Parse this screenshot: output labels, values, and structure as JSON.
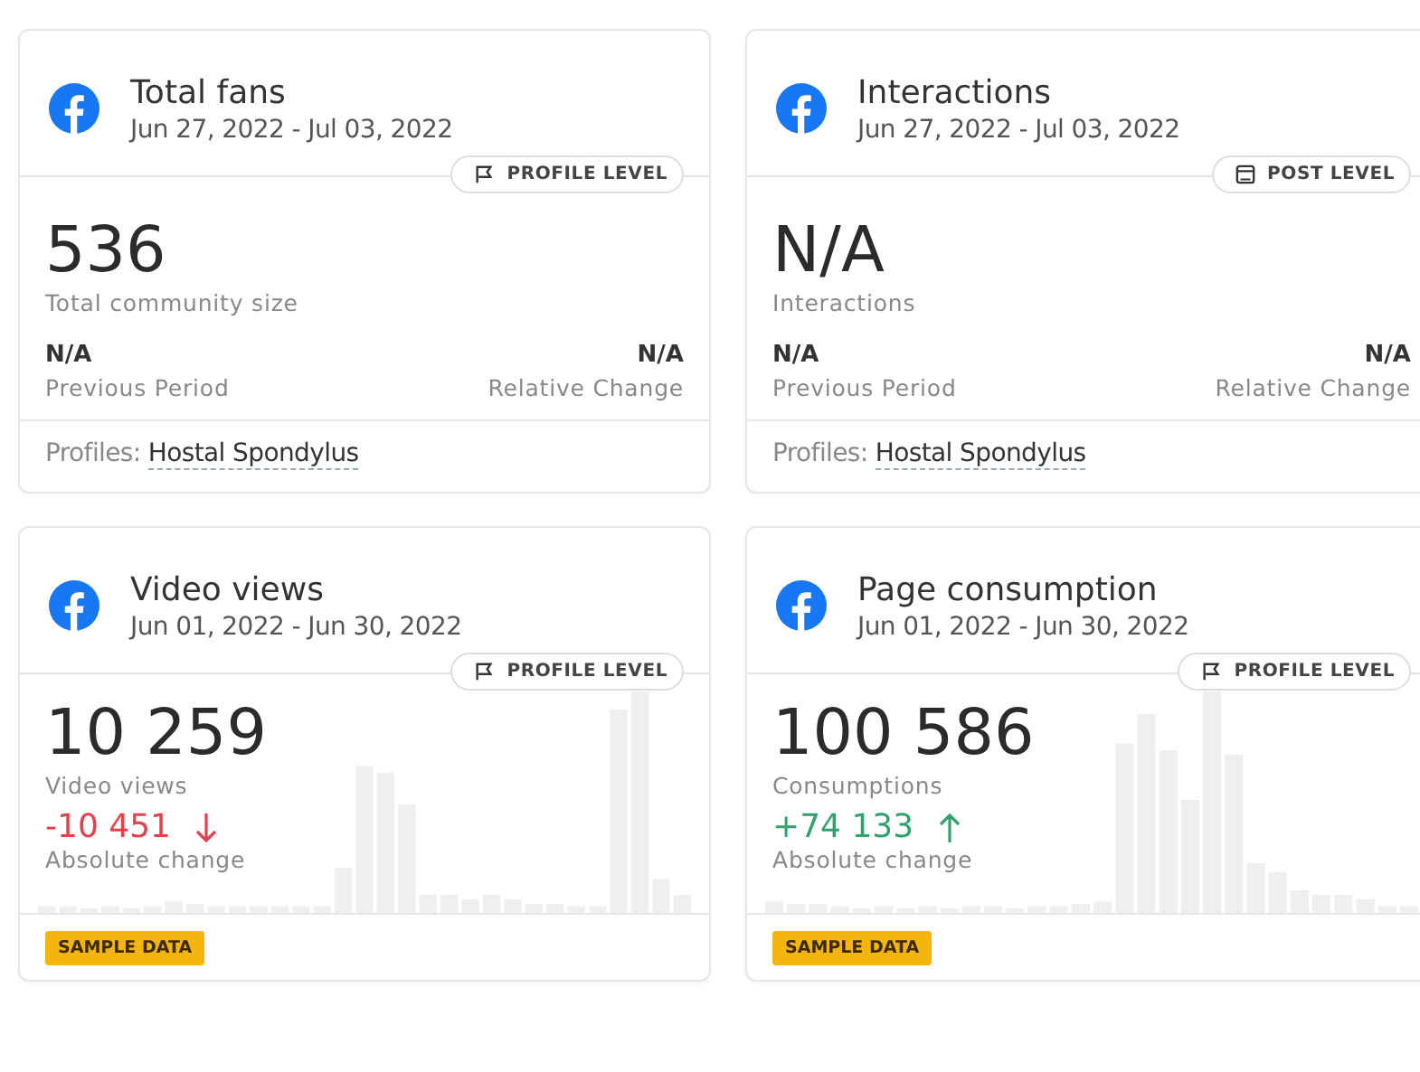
{
  "cards": [
    {
      "kind": "summary",
      "title": "Total fans",
      "date_range": "Jun 27, 2022 - Jul 03, 2022",
      "badge": {
        "kind": "profile",
        "label": "PROFILE LEVEL"
      },
      "value": "536",
      "value_label": "Total community size",
      "previous": {
        "value": "N/A",
        "label": "Previous Period"
      },
      "change": {
        "value": "N/A",
        "label": "Relative Change"
      },
      "profiles_label": "Profiles:",
      "profile_link": "Hostal Spondylus"
    },
    {
      "kind": "summary",
      "title": "Interactions",
      "date_range": "Jun 27, 2022 - Jul 03, 2022",
      "badge": {
        "kind": "post",
        "label": "POST LEVEL"
      },
      "value": "N/A",
      "value_label": "Interactions",
      "previous": {
        "value": "N/A",
        "label": "Previous Period"
      },
      "change": {
        "value": "N/A",
        "label": "Relative Change"
      },
      "profiles_label": "Profiles:",
      "profile_link": "Hostal Spondylus"
    },
    {
      "kind": "trend",
      "title": "Video views",
      "date_range": "Jun 01, 2022 - Jun 30, 2022",
      "badge": {
        "kind": "profile",
        "label": "PROFILE LEVEL"
      },
      "value": "10 259",
      "value_label": "Video views",
      "delta": {
        "value": "-10 451",
        "kind": "decrease",
        "label": "Absolute change"
      },
      "sample_badge": "SAMPLE DATA"
    },
    {
      "kind": "trend",
      "title": "Page consumption",
      "date_range": "Jun 01, 2022 - Jun 30, 2022",
      "badge": {
        "kind": "profile",
        "label": "PROFILE LEVEL"
      },
      "value": "100 586",
      "value_label": "Consumptions",
      "delta": {
        "value": "+74 133",
        "kind": "increase",
        "label": "Absolute change"
      },
      "sample_badge": "SAMPLE DATA"
    }
  ]
}
